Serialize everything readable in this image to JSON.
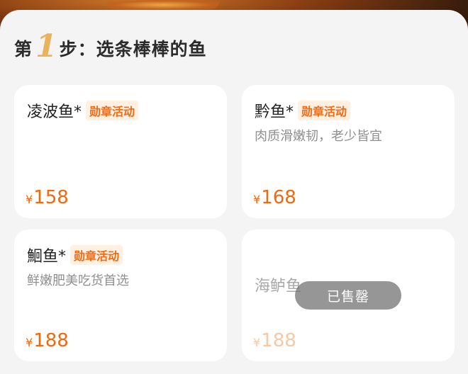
{
  "section": {
    "prefix": "第",
    "step_number": "1",
    "title": "步：选条棒棒的鱼"
  },
  "fish": [
    {
      "name": "凌波鱼*",
      "badge": "勋章活动",
      "desc": "",
      "currency": "¥",
      "price": "158"
    },
    {
      "name": "黔鱼*",
      "badge": "勋章活动",
      "desc": "肉质滑嫩韧，老少皆宜",
      "currency": "¥",
      "price": "168"
    },
    {
      "name": "鮰鱼*",
      "badge": "勋章活动",
      "desc": "鲜嫩肥美吃货首选",
      "currency": "¥",
      "price": "188"
    },
    {
      "name": "海鲈鱼",
      "badge": "",
      "desc": "",
      "currency": "¥",
      "price": "188",
      "status": "已售罄"
    }
  ],
  "colors": {
    "accent": "#f2690c",
    "badge_bg": "#fff0e1",
    "step_number": "#e8b35a"
  }
}
